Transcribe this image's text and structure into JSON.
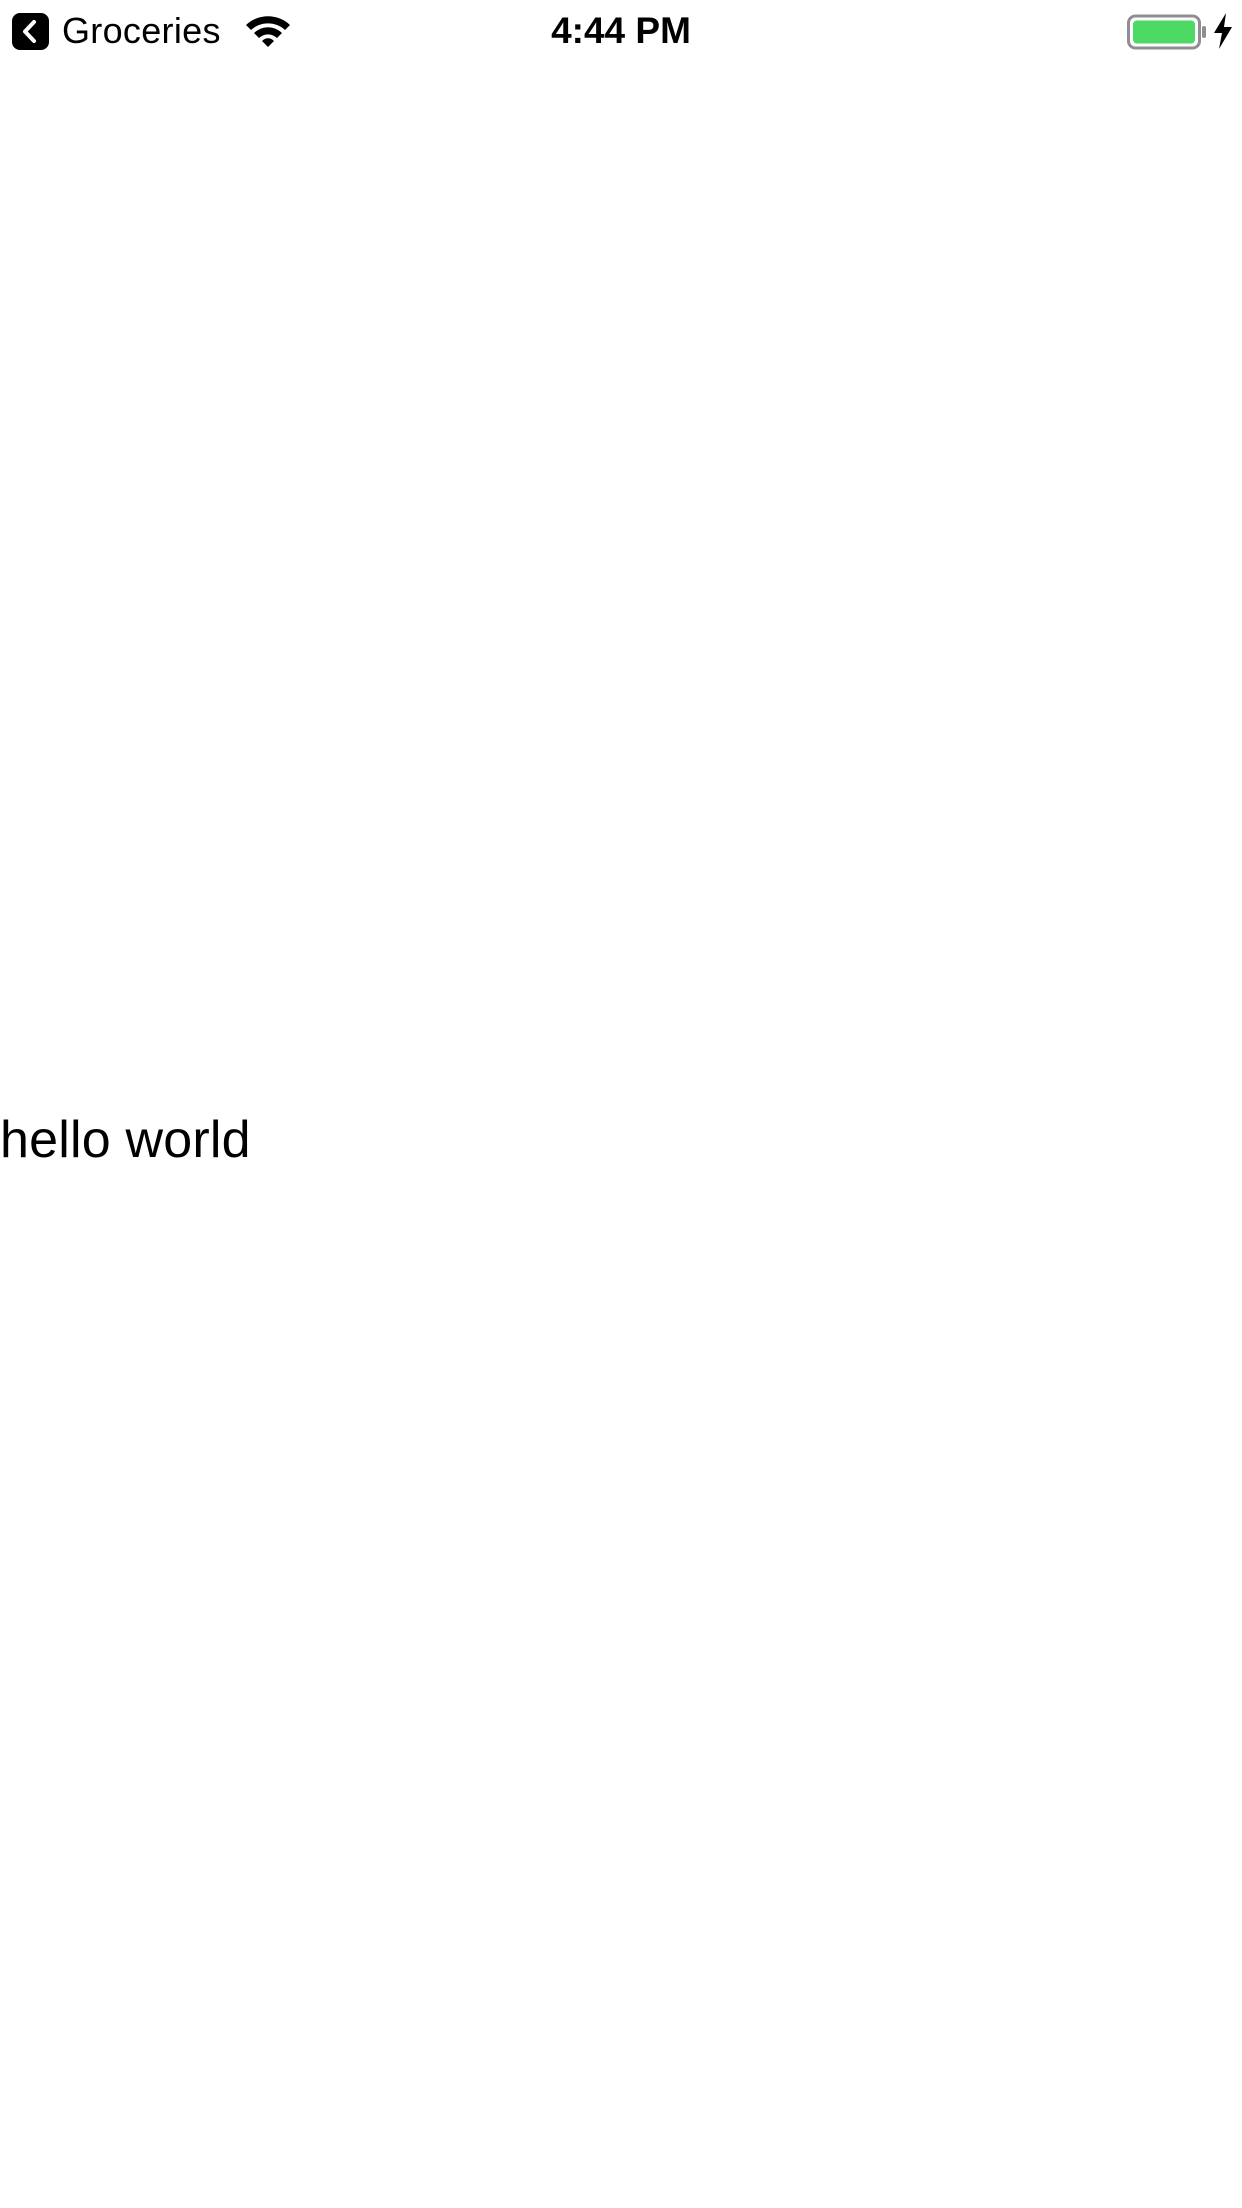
{
  "status_bar": {
    "back_app_label": "Groceries",
    "time": "4:44 PM",
    "battery_color": "#4cd964"
  },
  "content": {
    "text": "hello world"
  },
  "icons": {
    "back": "chevron-left-icon",
    "wifi": "wifi-icon",
    "battery": "battery-icon",
    "charging": "charging-bolt-icon"
  }
}
